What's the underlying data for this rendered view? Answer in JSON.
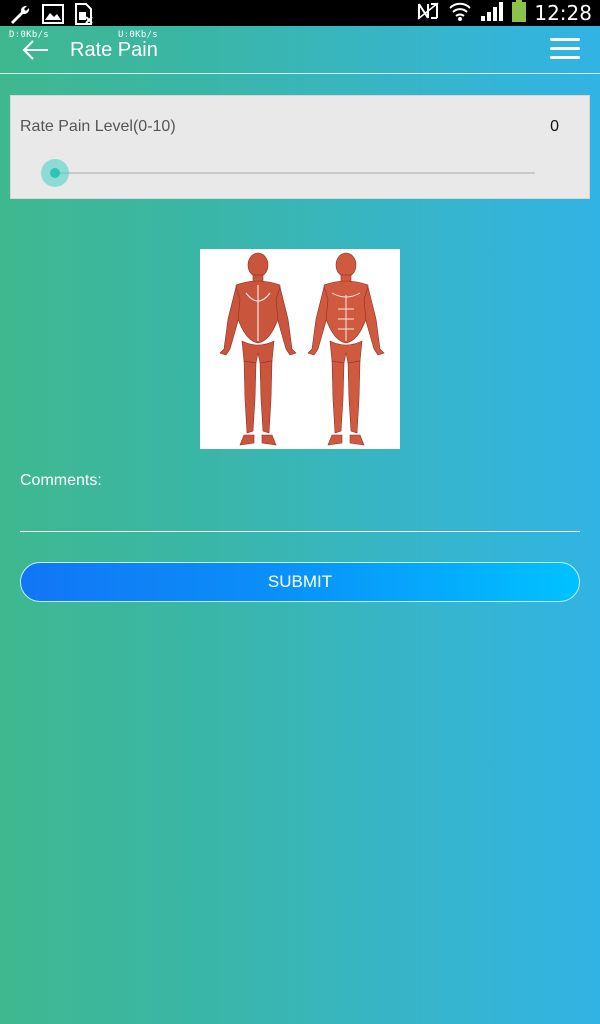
{
  "status_bar": {
    "time": "12:28",
    "icons": [
      "wrench-icon",
      "image-icon",
      "sim-card-icon",
      "nfc-icon",
      "wifi-icon",
      "signal-icon",
      "battery-icon"
    ]
  },
  "network_speed": {
    "download": "D:0Kb/s",
    "upload": "U:0Kb/s"
  },
  "toolbar": {
    "title": "Rate Pain"
  },
  "rate_card": {
    "label": "Rate Pain Level(0-10)",
    "value": "0",
    "slider": {
      "min": 0,
      "max": 10,
      "value": 0
    }
  },
  "comments": {
    "label": "Comments:",
    "value": ""
  },
  "submit": {
    "label": "SUBMIT"
  },
  "colors": {
    "gradient_left": "#3fb88f",
    "gradient_right": "#31b3e4",
    "slider_thumb": "#2fc3b3",
    "button_left": "#1276f5",
    "button_right": "#00c2ff"
  }
}
